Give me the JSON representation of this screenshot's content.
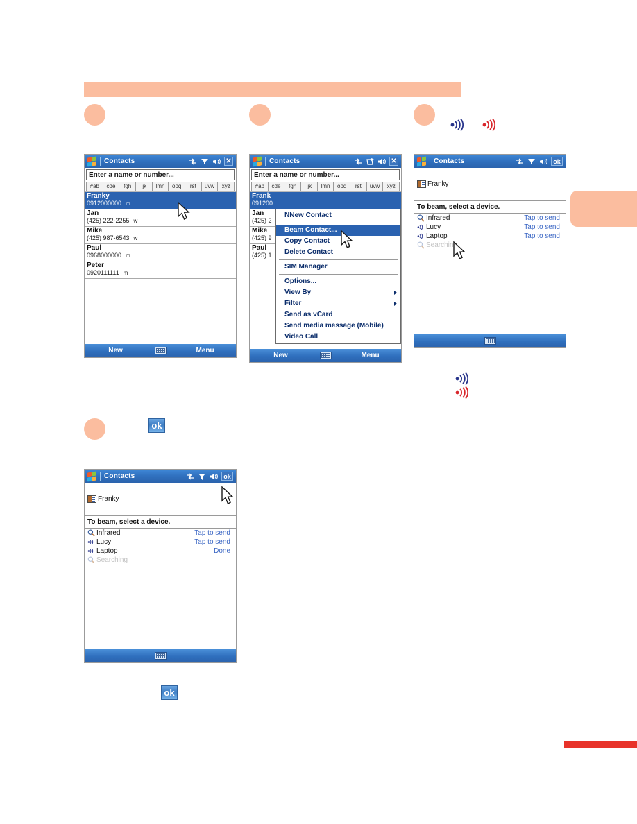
{
  "page": {
    "decor": {
      "bar_color": "#fbbd9f",
      "divider_color": "#e8a98b",
      "red_bar_color": "#e8332a",
      "accent_blue": "#2a62b0"
    }
  },
  "legend_icons": {
    "beam_blue_label": "beam-blue-icon",
    "beam_red_label": "beam-red-icon",
    "ok_label": "ok"
  },
  "screens": {
    "contacts_list": {
      "title": "Contacts",
      "search_value": "Enter a name or number...",
      "alpha_index": [
        "#ab",
        "cde",
        "fgh",
        "ijk",
        "lmn",
        "opq",
        "rst",
        "uvw",
        "xyz"
      ],
      "title_icons": [
        "connectivity-icon",
        "signal-icon",
        "speaker-icon",
        "close-icon"
      ],
      "contacts": [
        {
          "name": "Franky",
          "number": "0912000000",
          "type": "m",
          "selected": true
        },
        {
          "name": "Jan",
          "number": "(425) 222-2255",
          "type": "w",
          "selected": false
        },
        {
          "name": "Mike",
          "number": "(425) 987-6543",
          "type": "w",
          "selected": false
        },
        {
          "name": "Paul",
          "number": "0968000000",
          "type": "m",
          "selected": false
        },
        {
          "name": "Peter",
          "number": "0920111111",
          "type": "m",
          "selected": false
        }
      ],
      "softkeys": {
        "left": "New",
        "right": "Menu",
        "middle": "keyboard-icon"
      }
    },
    "contacts_menu": {
      "title": "Contacts",
      "search_value": "Enter a name or number...",
      "alpha_index": [
        "#ab",
        "cde",
        "fgh",
        "ijk",
        "lmn",
        "opq",
        "rst",
        "uvw",
        "xyz"
      ],
      "title_icons": [
        "connectivity-icon",
        "rotate-icon",
        "speaker-icon",
        "close-icon"
      ],
      "contacts": [
        {
          "name": "Frank",
          "number": "091200",
          "type": "",
          "selected": true
        },
        {
          "name": "Jan",
          "number": "(425) 2",
          "type": "",
          "selected": false
        },
        {
          "name": "Mike",
          "number": "(425) 9",
          "type": "",
          "selected": false
        },
        {
          "name": "Paul",
          "number": "(425) 1",
          "type": "",
          "selected": false
        }
      ],
      "menu_items": [
        {
          "label": "New Contact",
          "accel": "N",
          "selected": false,
          "submenu": false
        },
        {
          "sep": true
        },
        {
          "label": "Beam Contact...",
          "accel": "B",
          "selected": true,
          "submenu": false
        },
        {
          "label": "Copy Contact",
          "accel": "C",
          "selected": false,
          "submenu": false
        },
        {
          "label": "Delete Contact",
          "accel": "D",
          "selected": false,
          "submenu": false
        },
        {
          "sep": true
        },
        {
          "label": "SIM Manager",
          "accel": "I",
          "selected": false,
          "submenu": false
        },
        {
          "sep": true
        },
        {
          "label": "Options...",
          "accel": "O",
          "selected": false,
          "submenu": false
        },
        {
          "label": "View By",
          "accel": "V",
          "selected": false,
          "submenu": true
        },
        {
          "label": "Filter",
          "accel": "F",
          "selected": false,
          "submenu": true
        },
        {
          "label": "Send as vCard",
          "accel": "e",
          "selected": false,
          "submenu": false
        },
        {
          "label": "Send media message (Mobile)",
          "accel": "m",
          "selected": false,
          "submenu": false
        },
        {
          "label": "Video Call",
          "accel": "i",
          "selected": false,
          "submenu": false
        }
      ],
      "softkeys": {
        "left": "New",
        "right": "Menu",
        "middle": "keyboard-icon"
      }
    },
    "beam_select": {
      "title": "Contacts",
      "title_icons": [
        "connectivity-icon",
        "signal-icon",
        "speaker-icon",
        "ok-button"
      ],
      "ok_label": "ok",
      "contact_name": "Franky",
      "prompt": "To beam, select a device.",
      "devices": [
        {
          "name": "Infrared",
          "icon": "magnifier-icon",
          "status": "Tap to send",
          "dim": false
        },
        {
          "name": "Lucy",
          "icon": "beam-icon",
          "status": "Tap to send",
          "dim": false
        },
        {
          "name": "Laptop",
          "icon": "beam-icon",
          "status": "Tap to send",
          "dim": false
        },
        {
          "name": "Searching",
          "icon": "magnifier-icon",
          "status": "",
          "dim": true
        }
      ],
      "softkeys": {
        "left": "",
        "right": "",
        "middle": "keyboard-icon"
      }
    },
    "beam_done": {
      "title": "Contacts",
      "title_icons": [
        "connectivity-icon",
        "signal-icon",
        "speaker-icon",
        "ok-button"
      ],
      "ok_label": "ok",
      "contact_name": "Franky",
      "prompt": "To beam, select a device.",
      "devices": [
        {
          "name": "Infrared",
          "icon": "magnifier-icon",
          "status": "Tap to send",
          "dim": false
        },
        {
          "name": "Lucy",
          "icon": "beam-icon",
          "status": "Tap to send",
          "dim": false
        },
        {
          "name": "Laptop",
          "icon": "beam-icon",
          "status": "Done",
          "dim": false
        },
        {
          "name": "Searching",
          "icon": "magnifier-icon",
          "status": "",
          "dim": true
        }
      ],
      "softkeys": {
        "left": "",
        "right": "",
        "middle": "keyboard-icon"
      }
    }
  }
}
